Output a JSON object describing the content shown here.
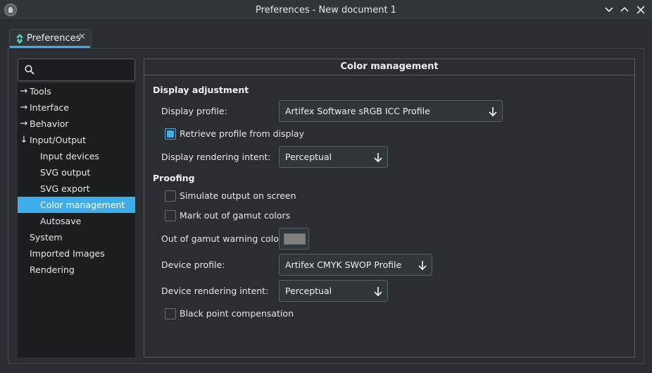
{
  "window": {
    "title": "Preferences - New document 1"
  },
  "tab": {
    "label": "Preferences",
    "close": "✕"
  },
  "search": {
    "placeholder": "",
    "value": ""
  },
  "nav": {
    "items": [
      {
        "label": "Tools",
        "arrow": "→",
        "expanded": false
      },
      {
        "label": "Interface",
        "arrow": "→",
        "expanded": false
      },
      {
        "label": "Behavior",
        "arrow": "→",
        "expanded": false
      },
      {
        "label": "Input/Output",
        "arrow": "↓",
        "expanded": true
      },
      {
        "label": "Input devices"
      },
      {
        "label": "SVG output"
      },
      {
        "label": "SVG export"
      },
      {
        "label": "Color management",
        "selected": true
      },
      {
        "label": "Autosave"
      },
      {
        "label": "System"
      },
      {
        "label": "Imported Images"
      },
      {
        "label": "Rendering"
      }
    ]
  },
  "panel": {
    "title": "Color management",
    "display_adjustment": {
      "heading": "Display adjustment",
      "display_profile_label": "Display profile:",
      "display_profile_value": "Artifex Software sRGB ICC Profile",
      "retrieve_label": "Retrieve profile from display",
      "retrieve_checked": true,
      "rendering_intent_label": "Display rendering intent:",
      "rendering_intent_value": "Perceptual"
    },
    "proofing": {
      "heading": "Proofing",
      "simulate_label": "Simulate output on screen",
      "simulate_checked": false,
      "gamut_label": "Mark out of gamut colors",
      "gamut_checked": false,
      "warning_color_label": "Out of gamut warning color:",
      "warning_color": "#808080",
      "device_profile_label": "Device profile:",
      "device_profile_value": "Artifex CMYK SWOP Profile",
      "device_intent_label": "Device rendering intent:",
      "device_intent_value": "Perceptual",
      "black_point_label": "Black point compensation",
      "black_point_checked": false
    }
  },
  "colors": {
    "accent": "#3daee9",
    "background": "#2a2e32",
    "tree_background": "#1b1e20"
  }
}
